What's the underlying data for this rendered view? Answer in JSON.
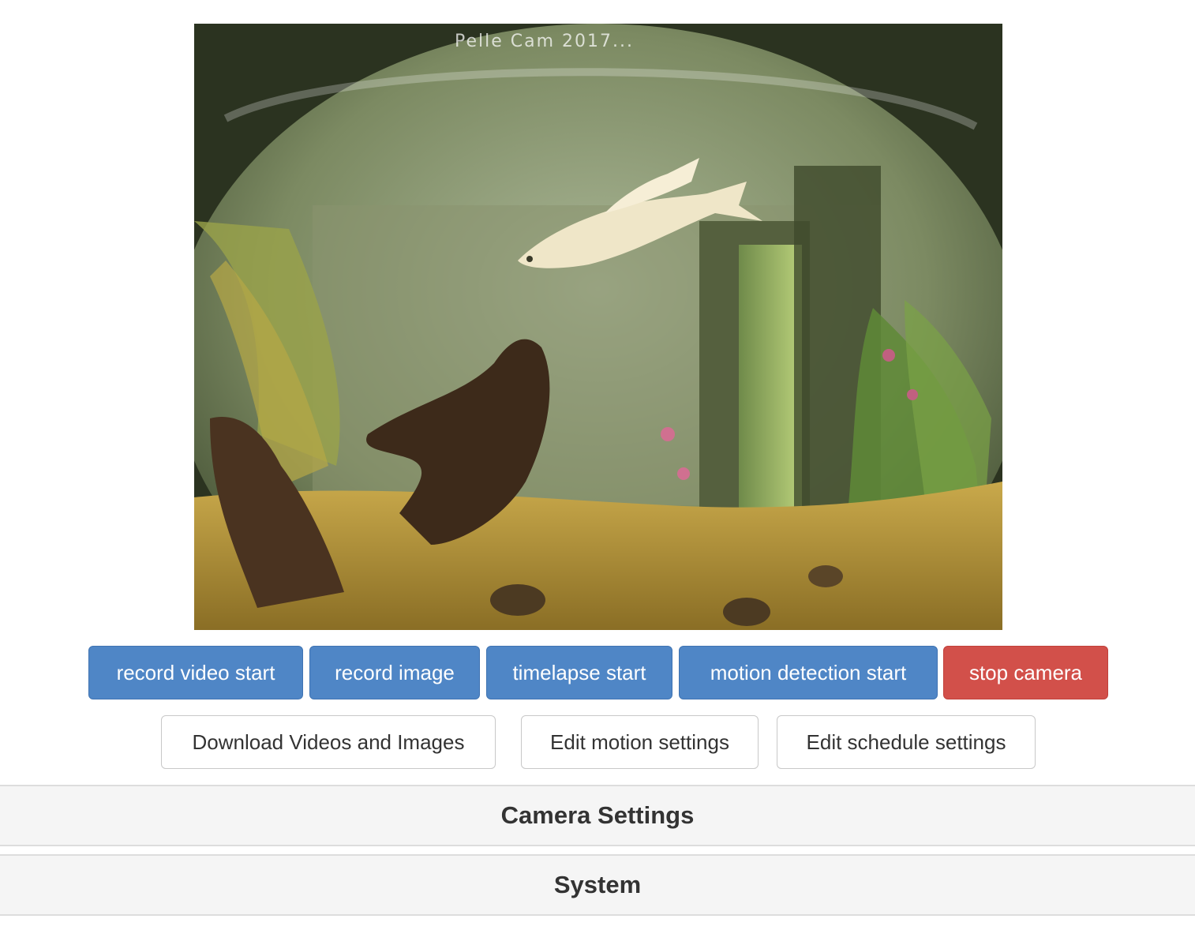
{
  "preview": {
    "overlay_text": "Pelle Cam 2017...",
    "alt": "camera preview"
  },
  "actions": {
    "record_video": "record video start",
    "record_image": "record image",
    "timelapse": "timelapse start",
    "motion_detection": "motion detection start",
    "stop_camera": "stop camera"
  },
  "links": {
    "download": "Download Videos and Images",
    "edit_motion": "Edit motion settings",
    "edit_schedule": "Edit schedule settings"
  },
  "panels": {
    "camera_settings": "Camera Settings",
    "system": "System"
  },
  "colors": {
    "primary": "#4f86c6",
    "danger": "#d2504a",
    "panel_bg": "#f5f5f5"
  }
}
